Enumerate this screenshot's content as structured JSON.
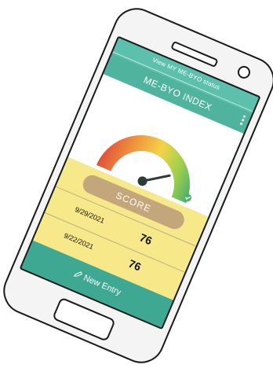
{
  "app": {
    "status_link": "View MY ME-BYO status",
    "title": "ME-BYO INDEX"
  },
  "gauge": {
    "colors": [
      "#e0503a",
      "#f09a3c",
      "#f3d34a",
      "#9fd04c",
      "#4fb06e"
    ],
    "level": 0.62
  },
  "score": {
    "label": "SCORE",
    "entries": [
      {
        "date": "9/29/2021",
        "value": "76"
      },
      {
        "date": "9/22/2021",
        "value": "76"
      }
    ]
  },
  "actions": {
    "new_entry": "New Entry"
  },
  "icons": {
    "menu": "vertical-dots-icon",
    "pencil": "pencil-icon",
    "gauge_badge": "check-icon"
  }
}
